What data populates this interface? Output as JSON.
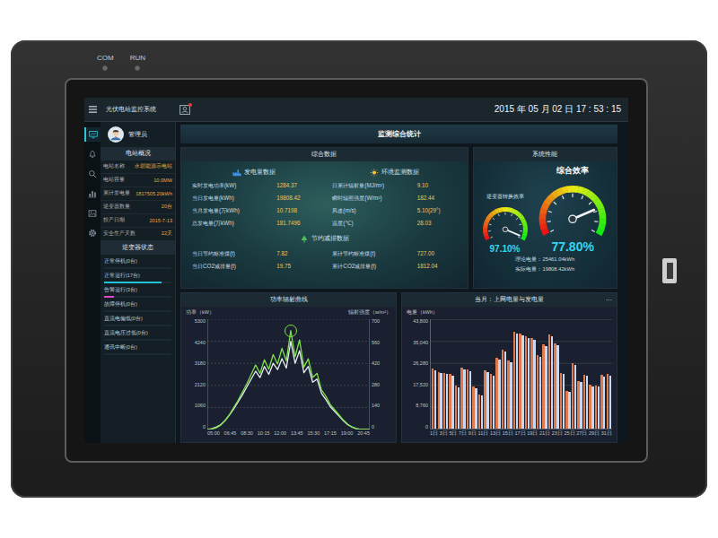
{
  "device": {
    "indicators": [
      {
        "label": "COM",
        "on": false
      },
      {
        "label": "RUN",
        "on": false
      }
    ]
  },
  "topbar": {
    "title": "光伏电站监控系统",
    "notification": {
      "unread": true
    },
    "datetime": "2015 年 05 月 02 日 17 : 53 : 15"
  },
  "nav": [
    {
      "selected": true
    },
    {
      "selected": false
    },
    {
      "selected": false
    },
    {
      "selected": false
    },
    {
      "selected": false
    },
    {
      "selected": false
    }
  ],
  "user": {
    "name": "管理员"
  },
  "station": {
    "title": "电站概况",
    "rows": [
      {
        "label": "电站名称",
        "value": "永碧能源示电站"
      },
      {
        "label": "电站容量",
        "value": "10.0MW"
      },
      {
        "label": "累计发电量",
        "value": "1817505.20kWh"
      },
      {
        "label": "逆变器数量",
        "value": "20台"
      },
      {
        "label": "投产日期",
        "value": "2015-7-13"
      },
      {
        "label": "安全生产天数",
        "value": "22天"
      }
    ]
  },
  "inverter_status": {
    "title": "逆变器状态",
    "items": [
      {
        "label": "正常停机(0台)",
        "level": 0,
        "color": "#3a8ee6"
      },
      {
        "label": "正常运行(17台)",
        "level": 0.85,
        "color": "#22c3d6"
      },
      {
        "label": "告警运行(3台)",
        "level": 0.15,
        "color": "#d64cc9"
      },
      {
        "label": "故障停机(0台)",
        "level": 0,
        "color": "#e04848"
      },
      {
        "label": "直流电偏低(0台)",
        "level": 0,
        "color": "#e0a030"
      },
      {
        "label": "直流电压过低(0台)",
        "level": 0,
        "color": "#9a60e0"
      },
      {
        "label": "通讯中断(0台)",
        "level": 0,
        "color": "#8a9aa8"
      }
    ]
  },
  "main_title": "监测综合统计",
  "summary": {
    "title": "综合数据",
    "generation": {
      "title": "发电量数据",
      "rows": [
        {
          "label": "实时发电功率(kW)",
          "value": "1284.37"
        },
        {
          "label": "当日发电量(kWh)",
          "value": "19808.42"
        },
        {
          "label": "当月发电量(万kWh)",
          "value": "10.7198"
        },
        {
          "label": "总发电量(万kWh)",
          "value": "181.7496"
        }
      ]
    },
    "environment": {
      "title": "环境监测数据",
      "rows": [
        {
          "label": "日累计辐射量(MJ/m²)",
          "value": "9.10"
        },
        {
          "label": "瞬时辐照强度(W/m²)",
          "value": "182.44"
        },
        {
          "label": "风速(m/s)",
          "value": "5.10(29°)"
        },
        {
          "label": "温度(℃)",
          "value": "28.03"
        }
      ]
    },
    "saving": {
      "title": "节约减排数据",
      "rows": [
        {
          "label": "当日节约标准煤(t)",
          "value": "7.82"
        },
        {
          "label": "当日CO2减排量(t)",
          "value": "19.75"
        },
        {
          "label": "累计节约标准煤(t)",
          "value": "727.00"
        },
        {
          "label": "累计CO2减排量(t)",
          "value": "1812.04"
        }
      ]
    }
  },
  "performance": {
    "title": "系统性能",
    "gauges": [
      {
        "label": "逆变器转换效率",
        "reading": "97.10%",
        "level": 0.971,
        "kind": "small"
      },
      {
        "label": "综合效率",
        "reading": "77.80%",
        "level": 0.778,
        "kind": "large"
      }
    ],
    "notes": [
      "理论电量：25461.04kWh",
      "实际电量：19808.42kWh"
    ]
  },
  "power_chart": {
    "title": "功率辐射曲线",
    "left_axis": {
      "label": "功率（kW）",
      "ticks": [
        "5300",
        "4240",
        "3180",
        "2120",
        "1060",
        "0"
      ]
    },
    "right_axis": {
      "label": "辐射强度（w/m²）",
      "ticks": [
        "700",
        "560",
        "420",
        "280",
        "140",
        "0"
      ]
    },
    "x_ticks": [
      "05:00",
      "06:45",
      "08:30",
      "10:15",
      "12:00",
      "13:45",
      "15:30",
      "17:15",
      "19:00",
      "20:45"
    ],
    "series": [
      {
        "axis": "right",
        "color": "#e6eef2",
        "values": [
          0,
          5,
          15,
          30,
          55,
          90,
          130,
          175,
          220,
          270,
          320,
          370,
          330,
          400,
          350,
          420,
          380,
          450,
          390,
          560,
          420,
          500,
          360,
          400,
          300,
          320,
          230,
          190,
          145,
          115,
          85,
          55,
          30,
          15,
          5,
          0,
          0,
          0
        ]
      },
      {
        "axis": "left",
        "color": "#7ee04a",
        "values": [
          0,
          20,
          80,
          200,
          420,
          700,
          1050,
          1400,
          1800,
          2200,
          2650,
          3100,
          2700,
          3350,
          2900,
          3600,
          3150,
          3900,
          3300,
          4750,
          3500,
          4300,
          3000,
          3400,
          2500,
          2700,
          1900,
          1600,
          1200,
          950,
          700,
          450,
          250,
          120,
          40,
          0,
          0,
          0
        ]
      }
    ]
  },
  "energy_chart": {
    "title": "当月：上网电量与发电量",
    "more": "···",
    "axis": {
      "label": "电量（kWh）",
      "ticks": [
        "43,800",
        "35,040",
        "26,280",
        "17,520",
        "8,760",
        "0"
      ]
    },
    "x_ticks": [
      "1日",
      "3日",
      "5日",
      "7日",
      "9日",
      "11日",
      "13日",
      "15日",
      "17日",
      "19日",
      "21日",
      "23日",
      "25日",
      "27日",
      "29日",
      "31日"
    ],
    "series": [
      {
        "color": "#e07b4f",
        "values": [
          24100,
          22800,
          22300,
          22000,
          17200,
          24300,
          23600,
          16800,
          13800,
          23400,
          21900,
          28200,
          31600,
          27300,
          38600,
          38200,
          36900,
          36100,
          29300,
          33600,
          37600,
          34100,
          22400,
          15200,
          26300,
          19200,
          21700,
          17600,
          17400,
          21600,
          21900
        ]
      },
      {
        "color": "#c8d8f0",
        "values": [
          23500,
          22100,
          21800,
          21300,
          16600,
          23700,
          22900,
          16200,
          13200,
          22800,
          21300,
          27500,
          30900,
          26700,
          37900,
          37500,
          36200,
          35400,
          28600,
          32900,
          36900,
          33400,
          21800,
          14700,
          25600,
          18600,
          21100,
          17000,
          16900,
          21000,
          21300
        ]
      }
    ]
  }
}
